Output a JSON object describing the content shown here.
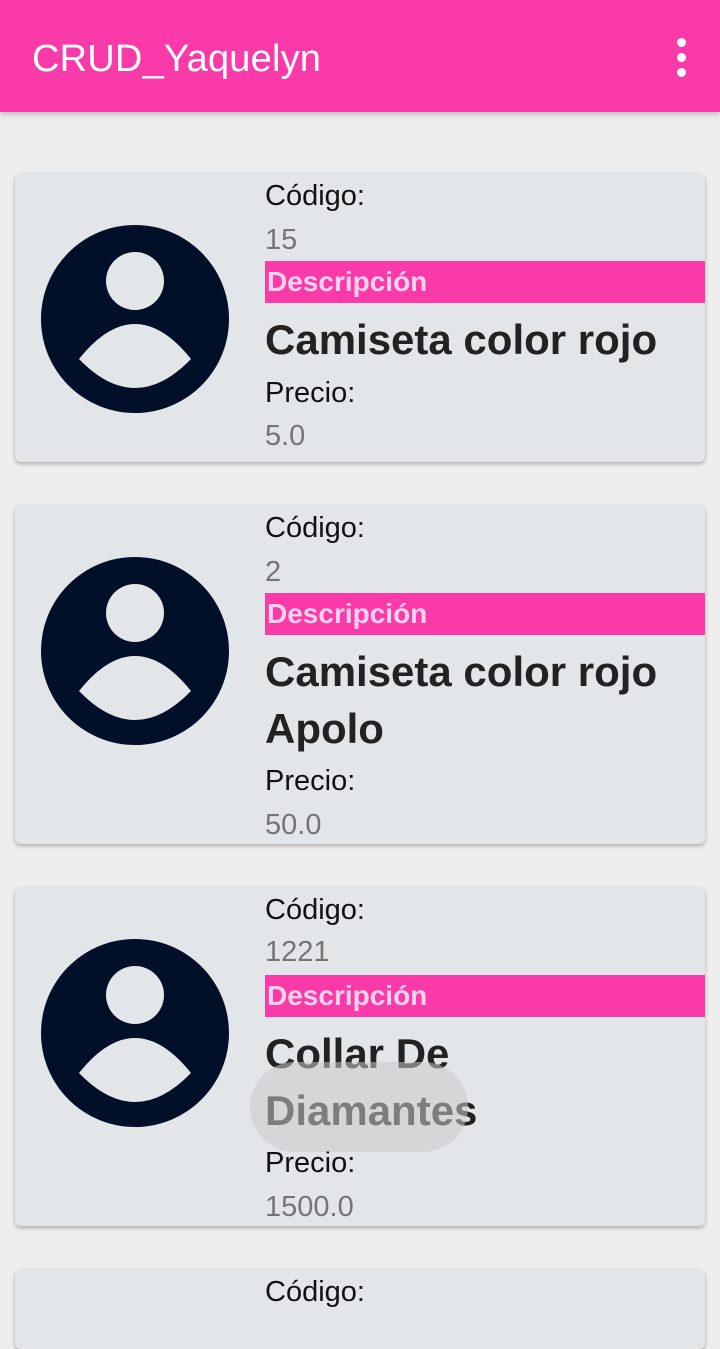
{
  "app": {
    "title": "CRUD_Yaquelyn",
    "menu_icon": "more-vert-icon",
    "accent_color": "#fb3aa9"
  },
  "products": [
    {
      "avatar_icon": "account-circle-icon",
      "code_label": "Código:",
      "code": "15",
      "description_label": "Descripción",
      "description": "Camiseta color rojo",
      "price_label": "Precio:",
      "price": "5.0"
    },
    {
      "avatar_icon": "account-circle-icon",
      "code_label": "Código:",
      "code": "2",
      "description_label": "Descripción",
      "description": "Camiseta color rojo\nApolo",
      "price_label": "Precio:",
      "price": "50.0"
    },
    {
      "avatar_icon": "account-circle-icon",
      "code_label": "Código:",
      "code": "1221",
      "description_label": "Descripción",
      "description": "Collar De\nDiamantes",
      "price_label": "Precio:",
      "price": "1500.0"
    },
    {
      "code_label": "Código:"
    }
  ]
}
